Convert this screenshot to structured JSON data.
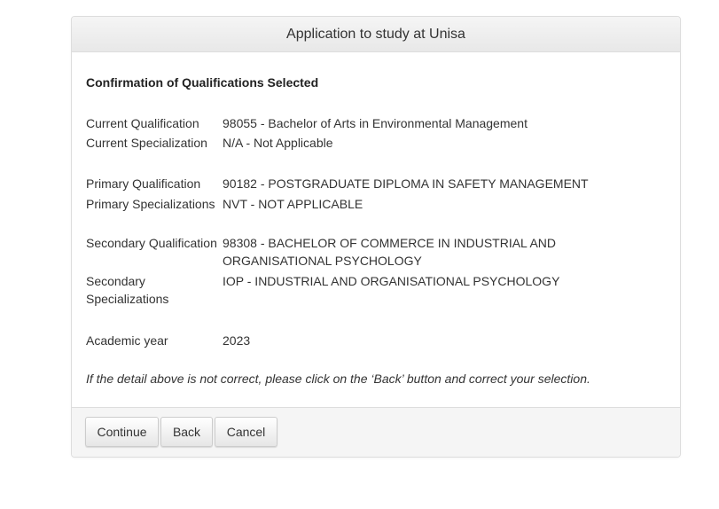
{
  "header": {
    "title": "Application to study at Unisa"
  },
  "confirmation": {
    "title": "Confirmation of Qualifications Selected",
    "rows": [
      {
        "label": "Current Qualification",
        "value": "98055 - Bachelor of Arts in Environmental Management"
      },
      {
        "label": "Current Specialization",
        "value": "N/A - Not Applicable"
      },
      {
        "label": "Primary Qualification",
        "value": "90182 - POSTGRADUATE DIPLOMA IN SAFETY MANAGEMENT"
      },
      {
        "label": "Primary Specializations",
        "value": "NVT - NOT APPLICABLE"
      },
      {
        "label": "Secondary Qualification",
        "value": "98308 - BACHELOR OF COMMERCE IN INDUSTRIAL AND ORGANISATIONAL PSYCHOLOGY"
      },
      {
        "label": "Secondary Specializations",
        "value": "IOP - INDUSTRIAL AND ORGANISATIONAL PSYCHOLOGY"
      },
      {
        "label": "Academic year",
        "value": "2023"
      }
    ],
    "note": "If the detail above is not correct, please click on the ‘Back’ button and correct your selection."
  },
  "footer": {
    "continue_label": "Continue",
    "back_label": "Back",
    "cancel_label": "Cancel"
  }
}
